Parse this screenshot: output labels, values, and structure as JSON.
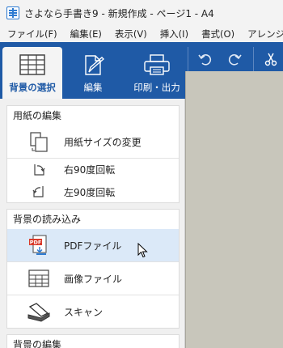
{
  "window": {
    "title": "さよなら手書き9 - 新規作成 - ページ1 - A4"
  },
  "menu": [
    "ファイル(F)",
    "編集(E)",
    "表示(V)",
    "挿入(I)",
    "書式(O)",
    "アレンジ"
  ],
  "ribbon": {
    "tabs": [
      {
        "label": "背景の選択",
        "icon": "background-select-icon",
        "active": true
      },
      {
        "label": "編集",
        "icon": "pen-edit-icon"
      },
      {
        "label": "印刷・出力",
        "icon": "printer-icon"
      }
    ],
    "tools": [
      "undo-icon",
      "redo-icon",
      "scissors-icon"
    ]
  },
  "panel": {
    "paper_edit": {
      "header": "用紙の編集",
      "items": [
        {
          "label": "用紙サイズの変更",
          "icon": "page-resize-icon"
        },
        {
          "label": "右90度回転",
          "icon": "rotate-right-icon"
        },
        {
          "label": "左90度回転",
          "icon": "rotate-left-icon"
        }
      ]
    },
    "bg_import": {
      "header": "背景の読み込み",
      "items": [
        {
          "label": "PDFファイル",
          "icon": "pdf-file-icon",
          "hover": true
        },
        {
          "label": "画像ファイル",
          "icon": "image-file-icon"
        },
        {
          "label": "スキャン",
          "icon": "scanner-icon"
        }
      ]
    },
    "bg_edit": {
      "header": "背景の編集"
    }
  },
  "colors": {
    "ribbon": "#1f5aa6",
    "hover": "#dbe9f8",
    "canvas": "#c8c6bb"
  }
}
